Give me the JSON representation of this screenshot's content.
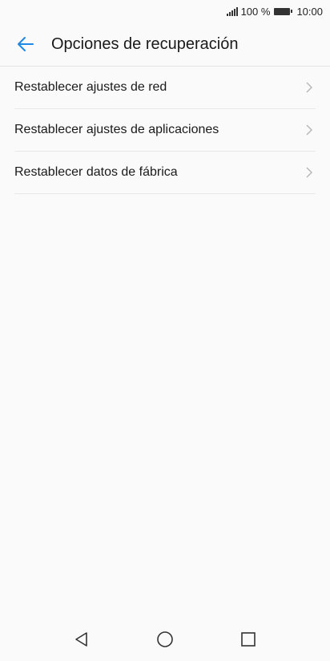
{
  "status_bar": {
    "battery_percent": "100 %",
    "time": "10:00",
    "icons": [
      "signal-icon",
      "battery-icon"
    ]
  },
  "app_bar": {
    "back_icon": "arrow-left-icon",
    "title": "Opciones de recuperación"
  },
  "options": [
    {
      "label": "Restablecer ajustes de red",
      "icon": "chevron-right-icon"
    },
    {
      "label": "Restablecer ajustes de aplicaciones",
      "icon": "chevron-right-icon"
    },
    {
      "label": "Restablecer datos de fábrica",
      "icon": "chevron-right-icon"
    }
  ],
  "nav_bar": {
    "icons": [
      "back-triangle-icon",
      "home-circle-icon",
      "recents-square-icon"
    ]
  },
  "colors": {
    "accent": "#1e88e5",
    "background": "#fafafa",
    "divider": "#e8e8e8",
    "text": "#1a1a1a",
    "chevron": "#b5b5b5"
  }
}
